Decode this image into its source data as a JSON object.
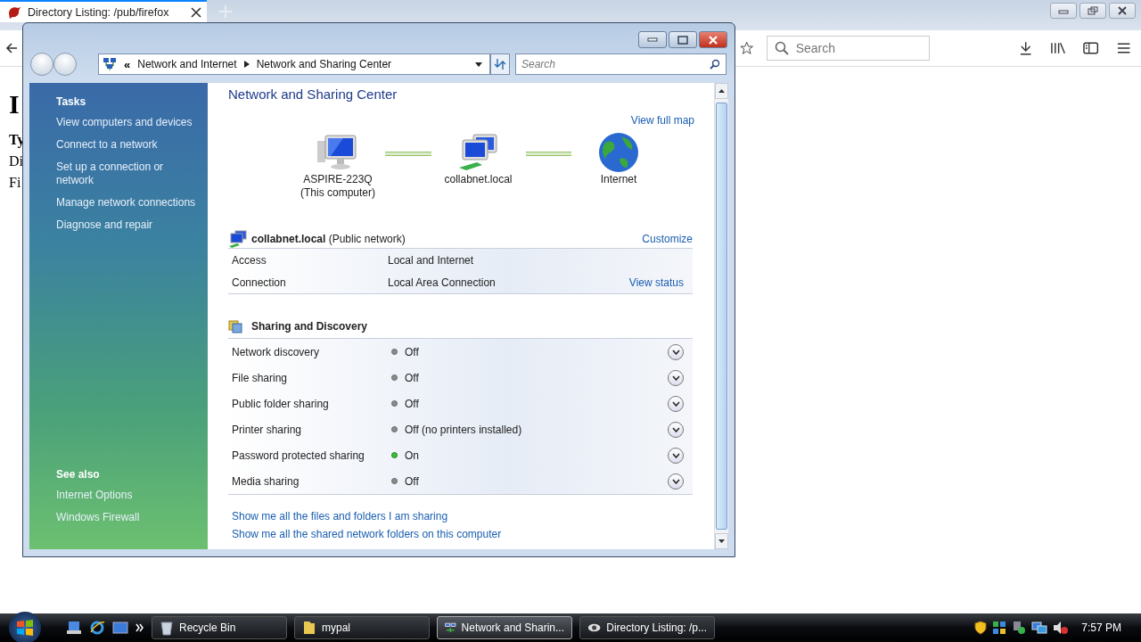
{
  "browser": {
    "tab": {
      "title": "Directory Listing: /pub/firefox"
    },
    "search": {
      "placeholder": "Search"
    },
    "page_text": [
      {
        "text": "I",
        "kind": "heading"
      },
      {
        "text": "Ty",
        "kind": "bold"
      },
      {
        "text": "Di",
        "kind": "plain"
      },
      {
        "text": "Fi",
        "kind": "plain"
      }
    ]
  },
  "window": {
    "address_prefix": "«",
    "breadcrumb": [
      "Network and Internet",
      "Network and Sharing Center"
    ],
    "search": {
      "placeholder": "Search"
    }
  },
  "sidebar": {
    "tasks_heading": "Tasks",
    "tasks": [
      "View computers and devices",
      "Connect to a network",
      "Set up a connection or network",
      "Manage network connections",
      "Diagnose and repair"
    ],
    "see_also_heading": "See also",
    "see_also": [
      "Internet Options",
      "Windows Firewall"
    ]
  },
  "main": {
    "title": "Network and Sharing Center",
    "view_full_map": "View full map",
    "map": [
      {
        "kind": "computer",
        "label": "ASPIRE-223Q",
        "sublabel": "(This computer)"
      },
      {
        "kind": "network",
        "label": "collabnet.local"
      },
      {
        "kind": "globe",
        "label": "Internet"
      }
    ],
    "network": {
      "name": "collabnet.local",
      "type": "(Public network)",
      "customize": "Customize"
    },
    "details": [
      {
        "label": "Access",
        "value": "Local and Internet"
      },
      {
        "label": "Connection",
        "value": "Local Area Connection",
        "link": "View status"
      }
    ],
    "sharing_heading": "Sharing and Discovery",
    "sharing": [
      {
        "label": "Network discovery",
        "status": "Off",
        "on": false
      },
      {
        "label": "File sharing",
        "status": "Off",
        "on": false
      },
      {
        "label": "Public folder sharing",
        "status": "Off",
        "on": false
      },
      {
        "label": "Printer sharing",
        "status": "Off (no printers installed)",
        "on": false
      },
      {
        "label": "Password protected sharing",
        "status": "On",
        "on": true
      },
      {
        "label": "Media sharing",
        "status": "Off",
        "on": false
      }
    ],
    "links": [
      "Show me all the files and folders I am sharing",
      "Show me all the shared network folders on this computer"
    ]
  },
  "taskbar": {
    "items": [
      {
        "label": "Recycle Bin",
        "kind": "bin",
        "selected": false
      },
      {
        "label": "mypal",
        "kind": "folder",
        "selected": false
      },
      {
        "label": "Network and Sharin...",
        "kind": "network",
        "selected": true
      },
      {
        "label": "Directory Listing: /p...",
        "kind": "browser",
        "selected": false
      }
    ],
    "clock": "7:57 PM"
  }
}
